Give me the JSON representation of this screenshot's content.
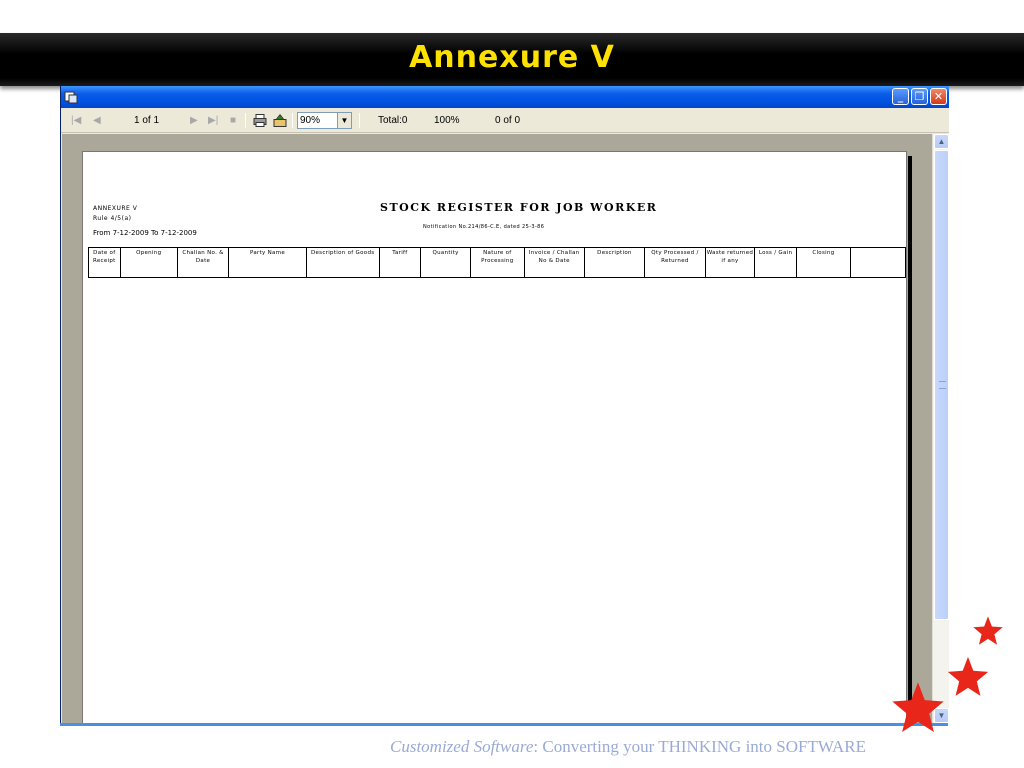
{
  "slide": {
    "title": "Annexure V",
    "tagline_italic": "Customized Software",
    "tagline_rest": ":   Converting your THINKING into SOFTWARE"
  },
  "window": {
    "controls": {
      "minimize": "_",
      "restore": "❐",
      "close": "✕"
    }
  },
  "toolbar": {
    "page_indicator": "1 of 1",
    "zoom": "90%",
    "total": "Total:0",
    "percent": "100%",
    "matched": "0 of 0"
  },
  "report": {
    "annexure": "ANNEXURE V",
    "rule": "Rule 4/5(a)",
    "from": "From 7-12-2009 To 7-12-2009",
    "title": "STOCK REGISTER FOR JOB WORKER",
    "notification": "Notification No.214/86-C.E, dated 25-3-86",
    "columns": [
      "Date of Receipt",
      "Opening",
      "Challan No. & Date",
      "Party Name",
      "Description of Goods",
      "Tariff",
      "Quantity",
      "Nature of Processing",
      "Invoice / Challan No & Date",
      "Description",
      "Qty Processed / Returned",
      "Waste returned if any",
      "Loss / Gain",
      "Closing",
      ""
    ]
  },
  "colors": {
    "title_text": "#ffe100",
    "title_bg": "#000000",
    "window_titlebar": "#0054e3",
    "viewer_bg": "#aca899",
    "stars": "#e8261a",
    "tagline": "#9aaad6"
  }
}
